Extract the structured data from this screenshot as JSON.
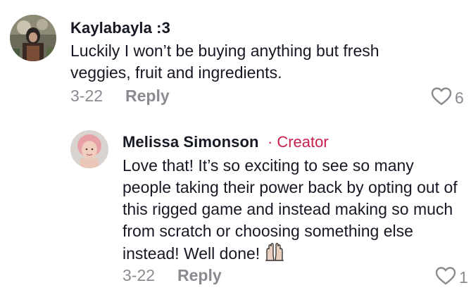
{
  "comments": [
    {
      "author": "Kaylabayla :3",
      "text": "Luckily I won’t be buying anything but fresh veggies, fruit and ingredients.",
      "date": "3-22",
      "reply_label": "Reply",
      "likes": "6"
    },
    {
      "author": "Melissa Simonson",
      "badge_separator": "·",
      "badge": "Creator",
      "text": "Love that! It’s so exciting to see so many people taking their power back by opting out of this rigged game and instead making so much from scratch or choosing something else instead! Well done!",
      "date": "3-22",
      "reply_label": "Reply",
      "likes": "1",
      "emoji": "raising-hands-icon"
    }
  ],
  "colors": {
    "text": "#161823",
    "muted": "#8a8b91",
    "creator": "#c81f4d"
  }
}
